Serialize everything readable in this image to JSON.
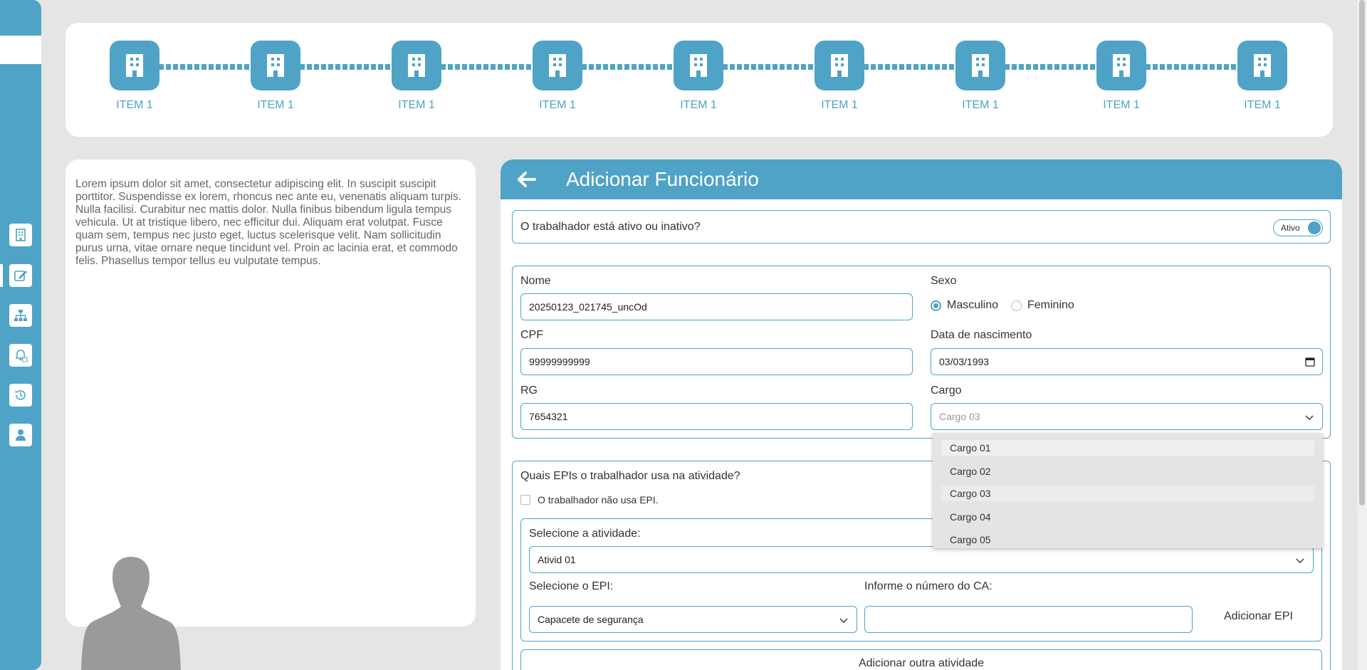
{
  "sidebar": {
    "icons": [
      "building-icon",
      "edit-icon",
      "org-chart-icon",
      "bell-document-icon",
      "history-icon",
      "user-icon"
    ]
  },
  "stepper": {
    "steps": [
      {
        "label": "ITEM 1"
      },
      {
        "label": "ITEM 1"
      },
      {
        "label": "ITEM 1"
      },
      {
        "label": "ITEM 1"
      },
      {
        "label": "ITEM 1"
      },
      {
        "label": "ITEM 1"
      },
      {
        "label": "ITEM 1"
      },
      {
        "label": "ITEM 1"
      },
      {
        "label": "ITEM 1"
      }
    ]
  },
  "info": {
    "text": "Lorem ipsum dolor sit amet, consectetur adipiscing elit. In suscipit suscipit porttitor. Suspendisse ex lorem, rhoncus nec ante eu, venenatis aliquam turpis. Nulla facilisi. Curabitur nec mattis dolor. Nulla finibus bibendum ligula tempus vehicula. Ut at tristique libero, nec efficitur dui. Aliquam erat volutpat. Fusce quam sem, tempus nec justo eget, luctus scelerisque velit. Nam sollicitudin purus urna, vitae ornare neque tincidunt vel. Proin ac lacinia erat, et commodo felis. Phasellus tempor tellus eu vulputate tempus."
  },
  "form": {
    "title": "Adicionar Funcionário",
    "active_question": "O trabalhador está ativo ou inativo?",
    "active_toggle_label": "Ativo",
    "name_label": "Nome",
    "name_value": "20250123_021745_uncOd",
    "sex_label": "Sexo",
    "sex_options": [
      "Masculino",
      "Feminino"
    ],
    "sex_selected": "Masculino",
    "cpf_label": "CPF",
    "cpf_value": "99999999999",
    "birth_label": "Data de nascimento",
    "birth_value": "03/03/1993",
    "rg_label": "RG",
    "rg_value": "7654321",
    "cargo_label": "Cargo",
    "cargo_placeholder": "Cargo 03",
    "cargo_options": [
      "Cargo 01",
      "Cargo 02",
      "Cargo 03",
      "Cargo 04",
      "Cargo 05"
    ],
    "epi_question": "Quais EPIs o trabalhador usa na atividade?",
    "no_epi_label": "O trabalhador não usa EPI.",
    "activity_label": "Selecione a atividade:",
    "activity_value": "Ativid 01",
    "epi_select_label": "Selecione o EPI:",
    "epi_select_value": "Capacete de segurança",
    "ca_label": "Informe o número do CA:",
    "ca_value": "",
    "add_epi_label": "Adicionar EPI",
    "add_activity_label": "Adicionar outra atividade"
  },
  "colors": {
    "accent": "#4fa3c6",
    "background": "#e5e5e5"
  }
}
